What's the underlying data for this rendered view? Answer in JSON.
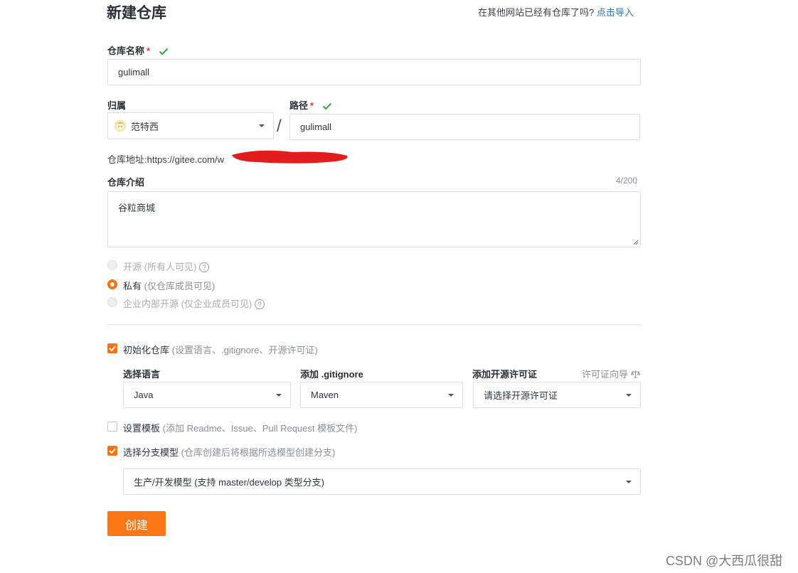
{
  "header": {
    "title": "新建仓库",
    "import_prompt": "在其他网站已经有仓库了吗?",
    "import_link": "点击导入"
  },
  "repo_name": {
    "label": "仓库名称",
    "required_mark": "*",
    "value": "gulimall"
  },
  "owner": {
    "label": "归属",
    "value": "范特西"
  },
  "path_separator": "/",
  "path": {
    "label": "路径",
    "required_mark": "*",
    "value": "gulimall"
  },
  "repo_url": {
    "label": "仓库地址:",
    "value": "https://gitee.com/w"
  },
  "description": {
    "label": "仓库介绍",
    "counter": "4/200",
    "value": "谷粒商城"
  },
  "visibility": {
    "options": [
      {
        "label": "开源",
        "hint": "(所有人可见)",
        "state": "disabled"
      },
      {
        "label": "私有",
        "hint": "(仅仓库成员可见)",
        "state": "selected"
      },
      {
        "label": "企业内部开源",
        "hint": "(仅企业成员可见)",
        "state": "disabled"
      }
    ]
  },
  "init_repo": {
    "label": "初始化仓库",
    "hint": "(设置语言、.gitignore、开源许可证)",
    "checked": true
  },
  "language": {
    "label": "选择语言",
    "value": "Java"
  },
  "gitignore": {
    "label": "添加 .gitignore",
    "value": "Maven"
  },
  "license": {
    "label": "添加开源许可证",
    "guide": "许可证向导",
    "placeholder": "请选择开源许可证"
  },
  "template": {
    "label": "设置模板",
    "hint": "(添加 Readme、Issue、Pull Request 模板文件)",
    "checked": false
  },
  "branch_model": {
    "label": "选择分支模型",
    "hint": "(仓库创建后将根据所选模型创建分支)",
    "checked": true,
    "value": "生产/开发模型 (支持 master/develop 类型分支)"
  },
  "create_button": "创建",
  "watermark": "CSDN @大西瓜很甜",
  "colors": {
    "accent": "#fb7614",
    "link": "#2f72c4",
    "check": "#3fa648",
    "required": "#e5313c",
    "redaction": "#e21d1d"
  }
}
